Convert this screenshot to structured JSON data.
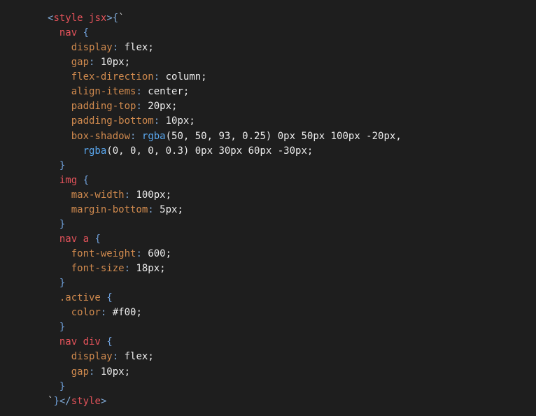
{
  "colors": {
    "background": "#1e1e1e",
    "tag": "#e5535b",
    "property": "#d08a4e",
    "function": "#5aa7ee",
    "brace": "#6f9fd8"
  },
  "code_lines": [
    [
      [
        "punct",
        "<"
      ],
      [
        "tag",
        "style"
      ],
      [
        "val",
        " "
      ],
      [
        "tag",
        "jsx"
      ],
      [
        "punct",
        ">{"
      ],
      [
        "str",
        "`"
      ]
    ],
    [
      [
        "val",
        "  "
      ],
      [
        "sel",
        "nav"
      ],
      [
        "val",
        " "
      ],
      [
        "brace",
        "{"
      ]
    ],
    [
      [
        "val",
        "    "
      ],
      [
        "prop",
        "display"
      ],
      [
        "punct",
        ":"
      ],
      [
        "val",
        " flex;"
      ]
    ],
    [
      [
        "val",
        "    "
      ],
      [
        "prop",
        "gap"
      ],
      [
        "punct",
        ":"
      ],
      [
        "val",
        " 10px;"
      ]
    ],
    [
      [
        "val",
        "    "
      ],
      [
        "prop",
        "flex-direction"
      ],
      [
        "punct",
        ":"
      ],
      [
        "val",
        " column;"
      ]
    ],
    [
      [
        "val",
        "    "
      ],
      [
        "prop",
        "align-items"
      ],
      [
        "punct",
        ":"
      ],
      [
        "val",
        " center;"
      ]
    ],
    [
      [
        "val",
        "    "
      ],
      [
        "prop",
        "padding-top"
      ],
      [
        "punct",
        ":"
      ],
      [
        "val",
        " 20px;"
      ]
    ],
    [
      [
        "val",
        "    "
      ],
      [
        "prop",
        "padding-bottom"
      ],
      [
        "punct",
        ":"
      ],
      [
        "val",
        " 10px;"
      ]
    ],
    [
      [
        "val",
        "    "
      ],
      [
        "prop",
        "box-shadow"
      ],
      [
        "punct",
        ":"
      ],
      [
        "val",
        " "
      ],
      [
        "fn",
        "rgba"
      ],
      [
        "val",
        "(50, 50, 93, 0.25) 0px 50px 100px -20px,"
      ]
    ],
    [
      [
        "val",
        "      "
      ],
      [
        "fn",
        "rgba"
      ],
      [
        "val",
        "(0, 0, 0, 0.3) 0px 30px 60px -30px;"
      ]
    ],
    [
      [
        "val",
        "  "
      ],
      [
        "brace",
        "}"
      ]
    ],
    [
      [
        "val",
        "  "
      ],
      [
        "sel",
        "img"
      ],
      [
        "val",
        " "
      ],
      [
        "brace",
        "{"
      ]
    ],
    [
      [
        "val",
        "    "
      ],
      [
        "prop",
        "max-width"
      ],
      [
        "punct",
        ":"
      ],
      [
        "val",
        " 100px;"
      ]
    ],
    [
      [
        "val",
        "    "
      ],
      [
        "prop",
        "margin-bottom"
      ],
      [
        "punct",
        ":"
      ],
      [
        "val",
        " 5px;"
      ]
    ],
    [
      [
        "val",
        "  "
      ],
      [
        "brace",
        "}"
      ]
    ],
    [
      [
        "val",
        "  "
      ],
      [
        "sel",
        "nav a"
      ],
      [
        "val",
        " "
      ],
      [
        "brace",
        "{"
      ]
    ],
    [
      [
        "val",
        "    "
      ],
      [
        "prop",
        "font-weight"
      ],
      [
        "punct",
        ":"
      ],
      [
        "val",
        " 600;"
      ]
    ],
    [
      [
        "val",
        "    "
      ],
      [
        "prop",
        "font-size"
      ],
      [
        "punct",
        ":"
      ],
      [
        "val",
        " 18px;"
      ]
    ],
    [
      [
        "val",
        "  "
      ],
      [
        "brace",
        "}"
      ]
    ],
    [
      [
        "val",
        "  "
      ],
      [
        "prop",
        ".active"
      ],
      [
        "val",
        " "
      ],
      [
        "brace",
        "{"
      ]
    ],
    [
      [
        "val",
        "    "
      ],
      [
        "prop",
        "color"
      ],
      [
        "punct",
        ":"
      ],
      [
        "val",
        " #f00;"
      ]
    ],
    [
      [
        "val",
        "  "
      ],
      [
        "brace",
        "}"
      ]
    ],
    [
      [
        "val",
        "  "
      ],
      [
        "sel",
        "nav div"
      ],
      [
        "val",
        " "
      ],
      [
        "brace",
        "{"
      ]
    ],
    [
      [
        "val",
        "    "
      ],
      [
        "prop",
        "display"
      ],
      [
        "punct",
        ":"
      ],
      [
        "val",
        " flex;"
      ]
    ],
    [
      [
        "val",
        "    "
      ],
      [
        "prop",
        "gap"
      ],
      [
        "punct",
        ":"
      ],
      [
        "val",
        " 10px;"
      ]
    ],
    [
      [
        "val",
        "  "
      ],
      [
        "brace",
        "}"
      ]
    ],
    [
      [
        "str",
        "`"
      ],
      [
        "brace",
        "}"
      ],
      [
        "punct",
        "</"
      ],
      [
        "tag",
        "style"
      ],
      [
        "punct",
        ">"
      ]
    ]
  ]
}
